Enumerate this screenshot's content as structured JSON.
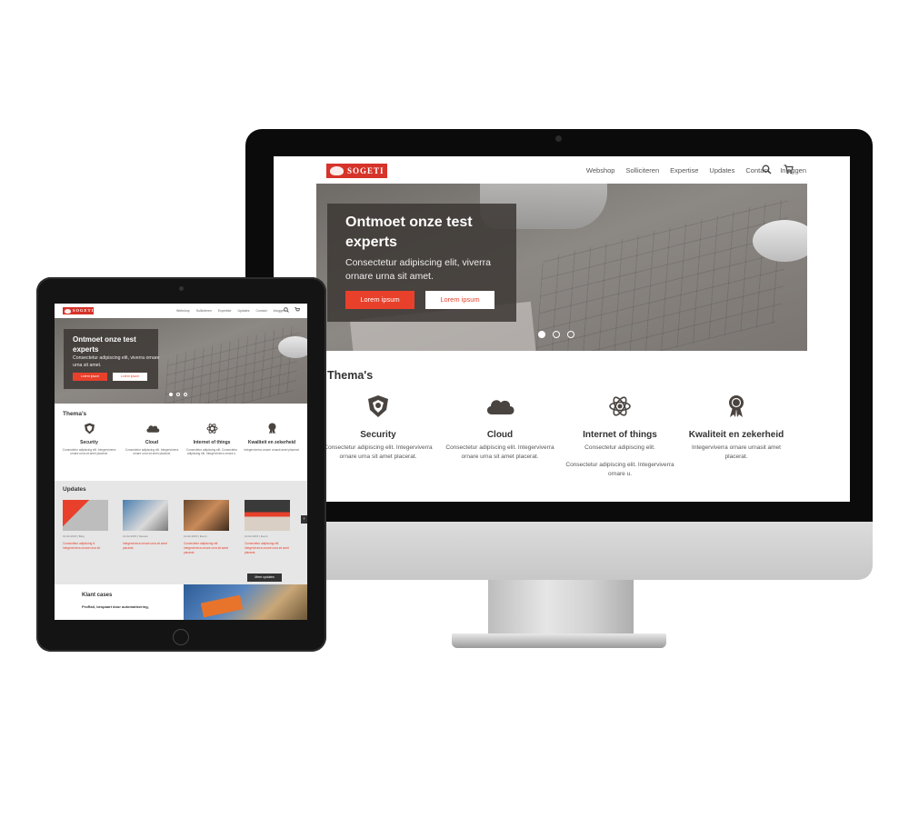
{
  "desktop": {
    "brand": "SOGETI",
    "nav": [
      "Webshop",
      "Solliciteren",
      "Expertise",
      "Updates",
      "Contact",
      "Inloggen"
    ],
    "icons": [
      "search-icon",
      "cart-icon"
    ],
    "hero": {
      "title": "Ontmoet onze test experts",
      "subtitle": "Consectetur adipiscing elit, viverra ornare urna sit amet.",
      "primary_button": "Lorem ipsum",
      "secondary_button": "Lorem ipsum",
      "slides": 3,
      "active_slide": 1
    },
    "themes_title": "Thema's",
    "themes": [
      {
        "title": "Security",
        "desc": "Consectetur adipiscing elit. Integerviverra ornare urna sit amet placerat.",
        "icon": "shield-icon"
      },
      {
        "title": "Cloud",
        "desc": "Consectetur adipiscing elit. Integerviverra ornare urna sit amet placerat.",
        "icon": "cloud-icon"
      },
      {
        "title": "Internet of things",
        "desc": "Consectetur adipiscing elit.\n\nConsectetur adipiscing elit. Integerviverra ornare u.",
        "icon": "atom-icon"
      },
      {
        "title": "Kwaliteit en zekerheid",
        "desc": "Integerviverra ornare urnasit amet placerat.",
        "icon": "award-ribbon-icon"
      }
    ]
  },
  "tablet": {
    "brand": "SOGETI",
    "nav": [
      "Webshop",
      "Solliciteren",
      "Expertise",
      "Updates",
      "Contact",
      "Inloggen"
    ],
    "hero": {
      "title": "Ontmoet onze test experts",
      "subtitle": "Consectetur adipiscing elit, viverra ornare urna sit amet.",
      "primary_button": "Lorem ipsum",
      "secondary_button": "Lorem ipsum"
    },
    "themes_title": "Thema's",
    "themes": [
      {
        "title": "Security",
        "desc": "Consectetur adipiscing elit. Integerviverra ornare urna sit amet placerat."
      },
      {
        "title": "Cloud",
        "desc": "Consectetur adipiscing elit. Integerviverra ornare urna sit amet placerat."
      },
      {
        "title": "Internet of things",
        "desc": "Consectetur adipiscing elit. Consectetur adipiscing elit. Integerviverra ornare u."
      },
      {
        "title": "Kwaliteit en zekerheid",
        "desc": "Integerviverra ornare urnasit amet placerat."
      }
    ],
    "updates_title": "Updates",
    "updates": [
      {
        "meta": "12-02-2015 | Blog",
        "text": "Consectetur adipiscing It. Integerviverra ornare urna sit"
      },
      {
        "meta": "12-02-2015 | Nieuws",
        "text": "Integerviverra ornare urna sit amet placerat."
      },
      {
        "meta": "12-02-2015 | Event",
        "text": "Consectetur adipiscing elit. Integerviverra ornare urna sit amet placerat."
      },
      {
        "meta": "12-02-2015 | Event",
        "text": "Consectetur adipiscing elit. Integerviverra ornare urna sit amet placerat."
      }
    ],
    "more_updates": "Meer updates",
    "clients_title": "Klant cases",
    "clients_sub": "ProRail, bespaart door automatisering,"
  },
  "colors": {
    "accent": "#e8402b",
    "brand": "#d6332a",
    "dark": "#333333"
  }
}
